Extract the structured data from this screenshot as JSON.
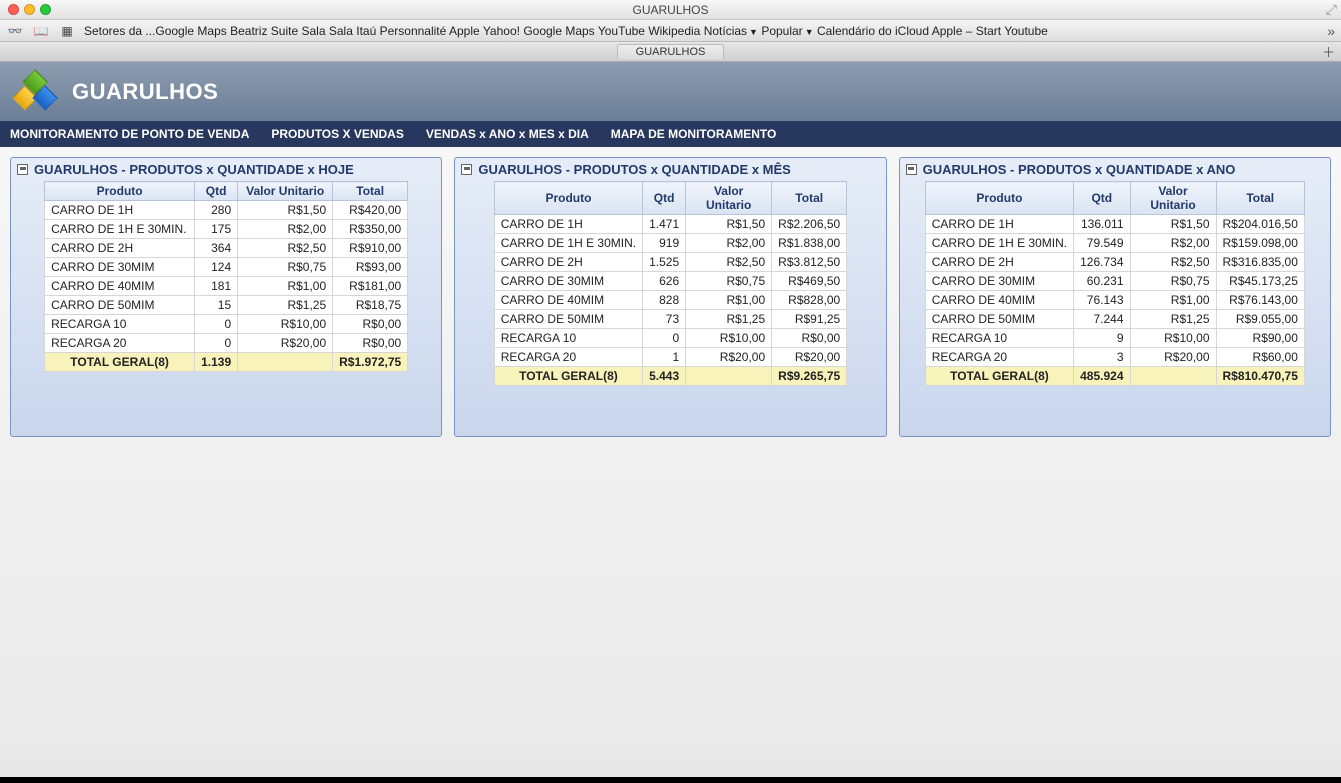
{
  "window": {
    "title": "GUARULHOS"
  },
  "toolbar": {
    "items": [
      {
        "label": "Setores da ...Google Maps"
      },
      {
        "label": "Beatriz"
      },
      {
        "label": "Suite"
      },
      {
        "label": "Sala"
      },
      {
        "label": "Sala"
      },
      {
        "label": "Itaú Personnalité"
      },
      {
        "label": "Apple"
      },
      {
        "label": "Yahoo!"
      },
      {
        "label": "Google Maps"
      },
      {
        "label": "YouTube"
      },
      {
        "label": "Wikipedia"
      },
      {
        "label": "Notícias",
        "dropdown": true
      },
      {
        "label": "Popular",
        "dropdown": true
      },
      {
        "label": "Calendário do iCloud"
      },
      {
        "label": "Apple – Start"
      },
      {
        "label": "Youtube"
      }
    ]
  },
  "tabbar": {
    "tab": "GUARULHOS"
  },
  "app": {
    "title": "GUARULHOS"
  },
  "nav": [
    "MONITORAMENTO DE PONTO DE VENDA",
    "PRODUTOS X VENDAS",
    "VENDAS x ANO x MES x DIA",
    "MAPA DE MONITORAMENTO"
  ],
  "columns": {
    "produto": "Produto",
    "qtd": "Qtd",
    "valor": "Valor Unitario",
    "total": "Total"
  },
  "panels": [
    {
      "title": "GUARULHOS - PRODUTOS x QUANTIDADE x HOJE",
      "col_widths": {
        "produto": 150,
        "qtd": 30,
        "valor": 95,
        "total": 62
      },
      "rows": [
        {
          "produto": "CARRO DE 1H",
          "qtd": "280",
          "valor": "R$1,50",
          "total": "R$420,00"
        },
        {
          "produto": "CARRO DE 1H E 30MIN.",
          "qtd": "175",
          "valor": "R$2,00",
          "total": "R$350,00"
        },
        {
          "produto": "CARRO DE 2H",
          "qtd": "364",
          "valor": "R$2,50",
          "total": "R$910,00"
        },
        {
          "produto": "CARRO DE 30MIM",
          "qtd": "124",
          "valor": "R$0,75",
          "total": "R$93,00"
        },
        {
          "produto": "CARRO DE 40MIM",
          "qtd": "181",
          "valor": "R$1,00",
          "total": "R$181,00"
        },
        {
          "produto": "CARRO DE 50MIM",
          "qtd": "15",
          "valor": "R$1,25",
          "total": "R$18,75"
        },
        {
          "produto": "RECARGA 10",
          "qtd": "0",
          "valor": "R$10,00",
          "total": "R$0,00"
        },
        {
          "produto": "RECARGA 20",
          "qtd": "0",
          "valor": "R$20,00",
          "total": "R$0,00"
        }
      ],
      "total": {
        "label": "TOTAL GERAL(8)",
        "qtd": "1.139",
        "valor": "",
        "total": "R$1.972,75"
      }
    },
    {
      "title": "GUARULHOS - PRODUTOS x QUANTIDADE x MÊS",
      "col_widths": {
        "produto": 145,
        "qtd": 38,
        "valor": 86,
        "total": 70
      },
      "rows": [
        {
          "produto": "CARRO DE 1H",
          "qtd": "1.471",
          "valor": "R$1,50",
          "total": "R$2.206,50"
        },
        {
          "produto": "CARRO DE 1H E 30MIN.",
          "qtd": "919",
          "valor": "R$2,00",
          "total": "R$1.838,00"
        },
        {
          "produto": "CARRO DE 2H",
          "qtd": "1.525",
          "valor": "R$2,50",
          "total": "R$3.812,50"
        },
        {
          "produto": "CARRO DE 30MIM",
          "qtd": "626",
          "valor": "R$0,75",
          "total": "R$469,50"
        },
        {
          "produto": "CARRO DE 40MIM",
          "qtd": "828",
          "valor": "R$1,00",
          "total": "R$828,00"
        },
        {
          "produto": "CARRO DE 50MIM",
          "qtd": "73",
          "valor": "R$1,25",
          "total": "R$91,25"
        },
        {
          "produto": "RECARGA 10",
          "qtd": "0",
          "valor": "R$10,00",
          "total": "R$0,00"
        },
        {
          "produto": "RECARGA 20",
          "qtd": "1",
          "valor": "R$20,00",
          "total": "R$20,00"
        }
      ],
      "total": {
        "label": "TOTAL GERAL(8)",
        "qtd": "5.443",
        "valor": "",
        "total": "R$9.265,75"
      }
    },
    {
      "title": "GUARULHOS - PRODUTOS x QUANTIDADE x ANO",
      "col_widths": {
        "produto": 140,
        "qtd": 52,
        "valor": 86,
        "total": 84
      },
      "rows": [
        {
          "produto": "CARRO DE 1H",
          "qtd": "136.011",
          "valor": "R$1,50",
          "total": "R$204.016,50"
        },
        {
          "produto": "CARRO DE 1H E 30MIN.",
          "qtd": "79.549",
          "valor": "R$2,00",
          "total": "R$159.098,00"
        },
        {
          "produto": "CARRO DE 2H",
          "qtd": "126.734",
          "valor": "R$2,50",
          "total": "R$316.835,00"
        },
        {
          "produto": "CARRO DE 30MIM",
          "qtd": "60.231",
          "valor": "R$0,75",
          "total": "R$45.173,25"
        },
        {
          "produto": "CARRO DE 40MIM",
          "qtd": "76.143",
          "valor": "R$1,00",
          "total": "R$76.143,00"
        },
        {
          "produto": "CARRO DE 50MIM",
          "qtd": "7.244",
          "valor": "R$1,25",
          "total": "R$9.055,00"
        },
        {
          "produto": "RECARGA 10",
          "qtd": "9",
          "valor": "R$10,00",
          "total": "R$90,00"
        },
        {
          "produto": "RECARGA 20",
          "qtd": "3",
          "valor": "R$20,00",
          "total": "R$60,00"
        }
      ],
      "total": {
        "label": "TOTAL GERAL(8)",
        "qtd": "485.924",
        "valor": "",
        "total": "R$810.470,75"
      }
    }
  ]
}
